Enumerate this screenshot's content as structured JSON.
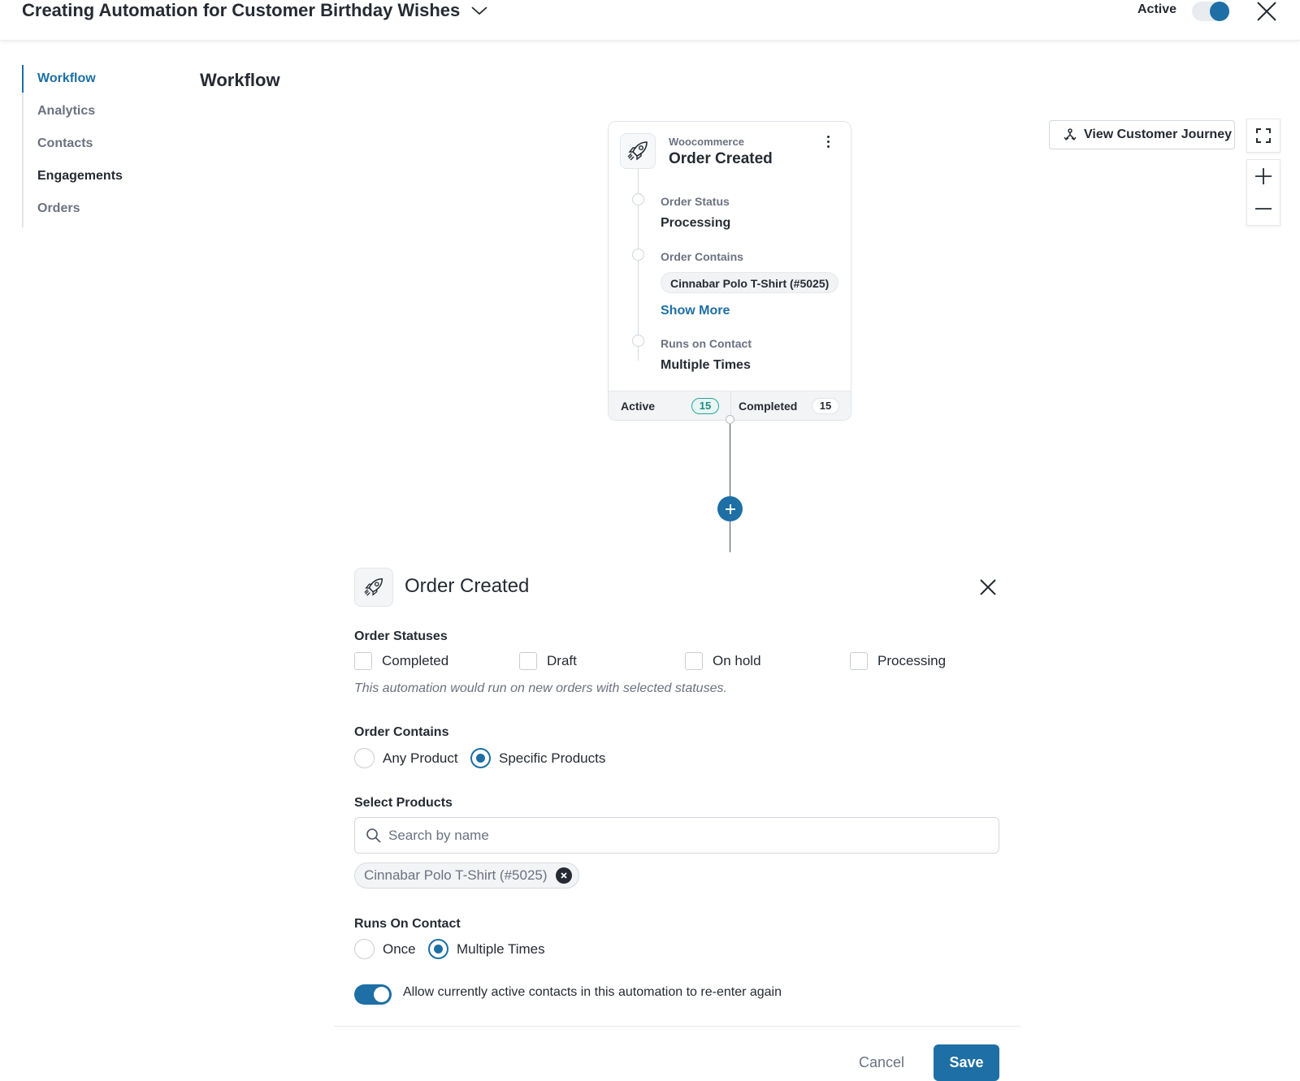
{
  "header": {
    "title": "Creating Automation for Customer Birthday Wishes",
    "status_label": "Active",
    "status_on": true
  },
  "sidebar": {
    "items": [
      {
        "label": "Workflow",
        "active": true
      },
      {
        "label": "Analytics"
      },
      {
        "label": "Contacts"
      },
      {
        "label": "Engagements"
      },
      {
        "label": "Orders"
      }
    ]
  },
  "main": {
    "title": "Workflow"
  },
  "trigger_card": {
    "source": "Woocommerce",
    "title": "Order Created",
    "order_status_label": "Order Status",
    "order_status_value": "Processing",
    "order_contains_label": "Order Contains",
    "order_contains_chip": "Cinnabar Polo T-Shirt (#5025)",
    "show_more": "Show More",
    "runs_on_label": "Runs on Contact",
    "runs_on_value": "Multiple Times",
    "active_label": "Active",
    "active_count": "15",
    "completed_label": "Completed",
    "completed_count": "15"
  },
  "tools": {
    "journey_button": "View Customer Journey"
  },
  "panel": {
    "title": "Order Created",
    "order_statuses_label": "Order Statuses",
    "statuses": [
      "Completed",
      "Draft",
      "On hold",
      "Processing"
    ],
    "statuses_hint": "This automation would run on new orders with selected statuses.",
    "order_contains_label": "Order Contains",
    "contains_options": [
      "Any Product",
      "Specific Products"
    ],
    "contains_selected": "Specific Products",
    "select_products_label": "Select Products",
    "search_placeholder": "Search by name",
    "selected_product": "Cinnabar Polo T-Shirt (#5025)",
    "runs_on_label": "Runs On Contact",
    "runs_options": [
      "Once",
      "Multiple Times"
    ],
    "runs_selected": "Multiple Times",
    "reenter_label": "Allow currently active contacts in this automation to re-enter again",
    "reenter_on": true,
    "cancel_label": "Cancel",
    "save_label": "Save"
  },
  "colors": {
    "accent": "#1d6fa5",
    "active_badge": "#26a69a"
  }
}
